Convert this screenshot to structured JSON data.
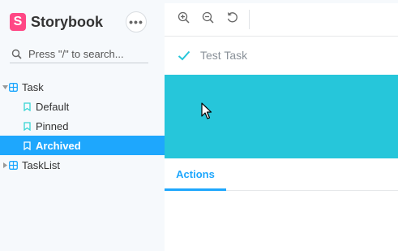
{
  "brand": {
    "title": "Storybook",
    "logo_letter": "S",
    "logo_color": "#ff4785"
  },
  "sidebar": {
    "menu_button_glyph": "•••",
    "search": {
      "placeholder": "Press \"/\" to search..."
    },
    "tree": [
      {
        "label": "Task",
        "type": "component",
        "expanded": true
      },
      {
        "label": "Default",
        "type": "story",
        "selected": false
      },
      {
        "label": "Pinned",
        "type": "story",
        "selected": false
      },
      {
        "label": "Archived",
        "type": "story",
        "selected": true
      },
      {
        "label": "TaskList",
        "type": "component",
        "expanded": false
      }
    ]
  },
  "toolbar": {
    "tools": [
      "zoom-in-icon",
      "zoom-out-icon",
      "zoom-reset-icon"
    ]
  },
  "preview": {
    "task_title": "Test Task",
    "task_state": "archived",
    "band_color": "#26c6da"
  },
  "addons": {
    "tabs": [
      {
        "label": "Actions",
        "active": true
      }
    ]
  },
  "colors": {
    "accent": "#1ea7fd",
    "sidebar_bg": "#f6f9fc"
  }
}
